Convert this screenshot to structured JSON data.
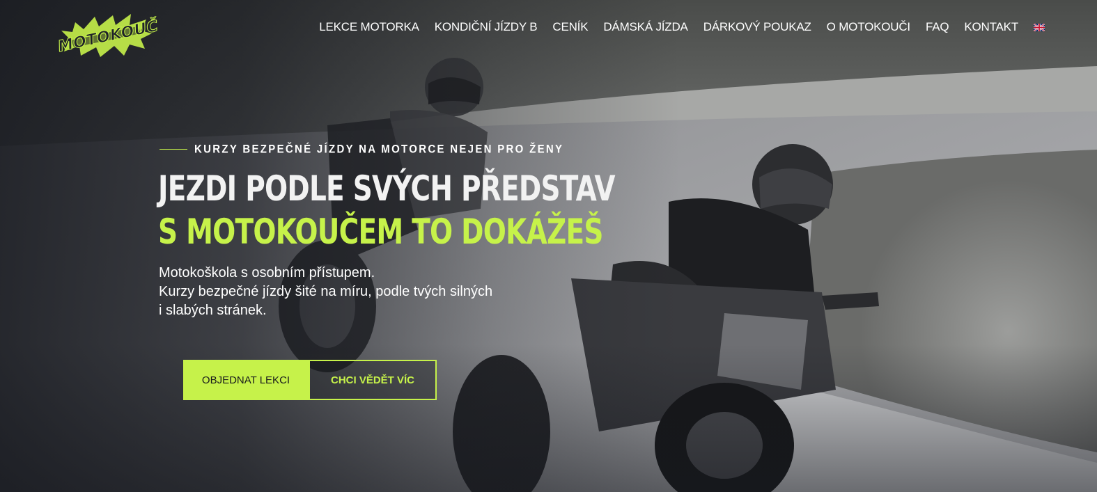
{
  "brand": {
    "logo_text": "MOTOKOUČ",
    "accent_color": "#c6f24a"
  },
  "nav": {
    "items": [
      {
        "label": "LEKCE MOTORKA"
      },
      {
        "label": "KONDIČNÍ JÍZDY B"
      },
      {
        "label": "CENÍK"
      },
      {
        "label": "DÁMSKÁ JÍZDA"
      },
      {
        "label": "DÁRKOVÝ POUKAZ"
      },
      {
        "label": "O MOTOKOUČI"
      },
      {
        "label": "FAQ"
      },
      {
        "label": "KONTAKT"
      }
    ],
    "language_icon": "uk-flag-icon"
  },
  "hero": {
    "kicker": "KURZY BEZPEČNÉ JÍZDY NA MOTORCE NEJEN PRO ŽENY",
    "headline_line1": "JEZDI PODLE SVÝCH PŘEDSTAV",
    "headline_line2": "S MOTOKOUČEM TO DOKÁŽEŠ",
    "lead_line1": "Motokoškola s osobním přístupem.",
    "lead_line2": "Kurzy bezpečné jízdy šité na míru, podle tvých silných i slabých stránek.",
    "primary_button": "OBJEDNAT LEKCI",
    "secondary_button": "CHCI VĚDĚT VÍC"
  }
}
